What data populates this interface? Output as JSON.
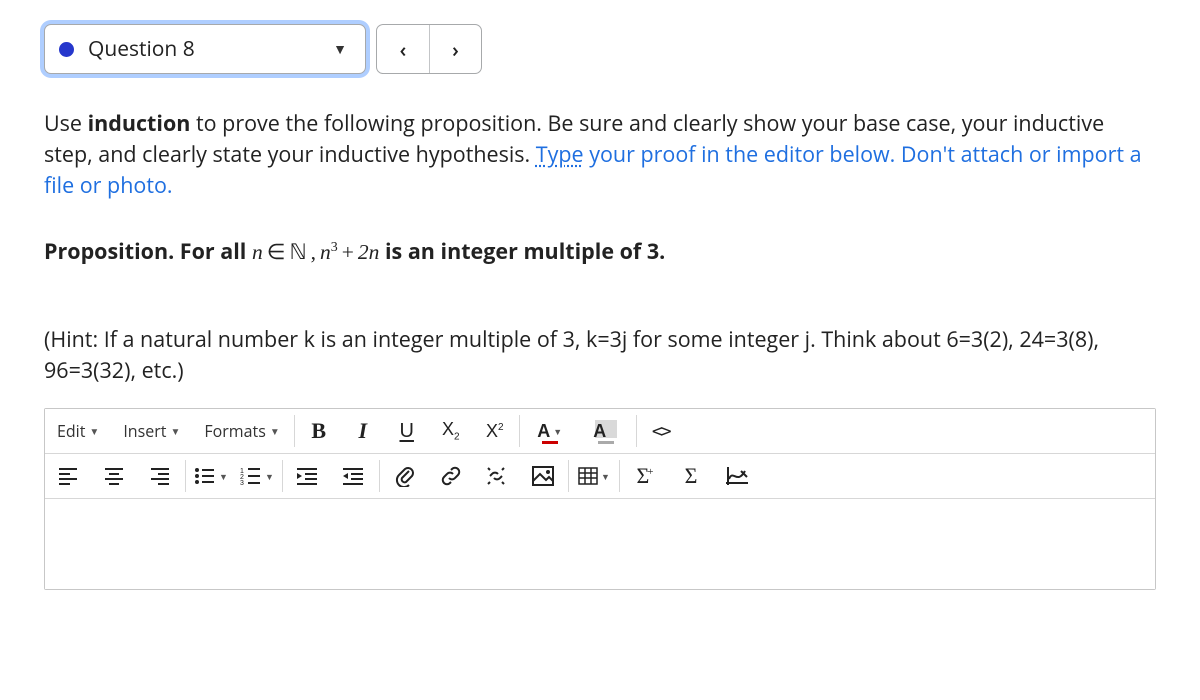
{
  "header": {
    "question_label": "Question 8"
  },
  "prompt": {
    "leadA": "Use ",
    "strong": "induction",
    "leadB": " to prove the following proposition. Be sure and clearly show your base case, your inductive step, and clearly state your inductive hypothesis.  ",
    "typeword": "Type",
    "blue_tail": " your proof in the editor below. Don't attach or import a file or photo."
  },
  "proposition": {
    "label": "Proposition. For all ",
    "math_html": "n ∈ ℕ , n³ + 2n",
    "tail": " is an integer multiple of 3."
  },
  "hint": "(Hint: If a natural number k is an integer multiple of 3, k=3j for some integer j. Think about 6=3(2), 24=3(8),  96=3(32), etc.)",
  "toolbar": {
    "menus": {
      "edit": "Edit",
      "insert": "Insert",
      "formats": "Formats"
    },
    "icons": {
      "bold": "bold-icon",
      "italic": "italic-icon",
      "underline": "underline-icon",
      "subscript": "subscript-icon",
      "superscript": "superscript-icon",
      "text_color": "text-color-icon",
      "bg_color": "bg-color-icon",
      "code": "code-icon",
      "align_left": "align-left-icon",
      "align_center": "align-center-icon",
      "align_right": "align-right-icon",
      "bullets": "bullet-list-icon",
      "numbers": "number-list-icon",
      "outdent": "outdent-icon",
      "indent": "indent-icon",
      "attach": "attachment-icon",
      "link": "link-icon",
      "unlink": "unlink-icon",
      "image": "image-icon",
      "table": "table-icon",
      "eq_insert": "equation-insert-icon",
      "eq": "equation-icon",
      "graph": "graph-icon"
    }
  }
}
